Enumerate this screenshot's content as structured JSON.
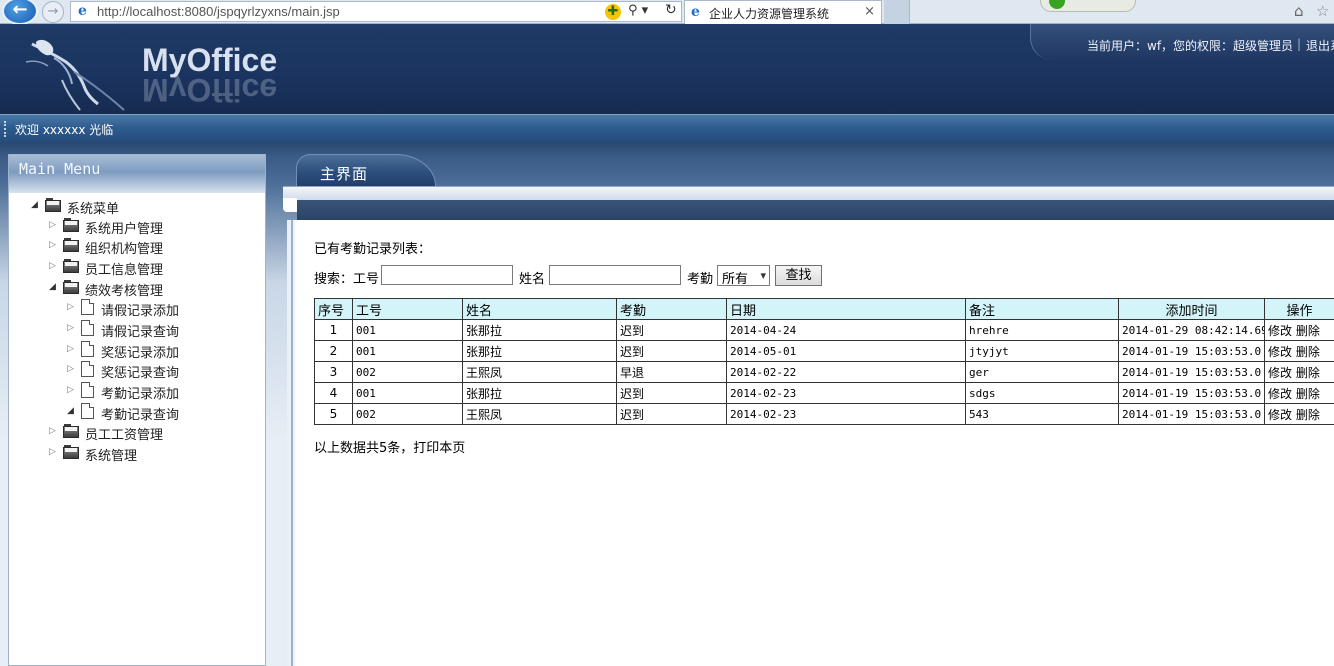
{
  "browser": {
    "url": "http://localhost:8080/jspqyrlzyxns/main.jsp",
    "tab_title": "企业人力资源管理系统",
    "back_glyph": "←",
    "forward_glyph": "→",
    "search_glyph": "⚲ ▾",
    "refresh_glyph": "↻",
    "close_glyph": "×"
  },
  "header": {
    "logo_text": "MyOffice",
    "user_info": "当前用户：wf，您的权限：超级管理员",
    "separator": "|",
    "logout_label": "退出系"
  },
  "welcome": {
    "text": "欢迎 xxxxxx 光临"
  },
  "sidebar": {
    "title": "Main Menu",
    "root_label": "系统菜单",
    "items": [
      {
        "label": "系统用户管理"
      },
      {
        "label": "组织机构管理"
      },
      {
        "label": "员工信息管理"
      },
      {
        "label": "绩效考核管理"
      },
      {
        "label": "请假记录添加"
      },
      {
        "label": "请假记录查询"
      },
      {
        "label": "奖惩记录添加"
      },
      {
        "label": "奖惩记录查询"
      },
      {
        "label": "考勤记录添加"
      },
      {
        "label": "考勤记录查询"
      },
      {
        "label": "员工工资管理"
      },
      {
        "label": "系统管理"
      }
    ]
  },
  "main": {
    "tab_label": "主界面",
    "list_title": "已有考勤记录列表：",
    "search": {
      "prefix_label": "搜索：工号：",
      "name_label": "姓名",
      "attendance_label": "考勤",
      "attendance_selected": "所有",
      "button_label": "查找",
      "id_value": "",
      "name_value": ""
    },
    "table": {
      "headers": [
        "序号",
        "工号",
        "姓名",
        "考勤",
        "日期",
        "备注",
        "添加时间",
        "操作"
      ],
      "rows": [
        {
          "no": "1",
          "id": "001",
          "name": "张那拉",
          "attendance": "迟到",
          "date": "2014-04-24",
          "note": "hrehre",
          "added": "2014-01-29 08:42:14.69",
          "edit": "修改",
          "delete": "删除"
        },
        {
          "no": "2",
          "id": "001",
          "name": "张那拉",
          "attendance": "迟到",
          "date": "2014-05-01",
          "note": "jtyjyt",
          "added": "2014-01-19 15:03:53.0",
          "edit": "修改",
          "delete": "删除"
        },
        {
          "no": "3",
          "id": "002",
          "name": "王熙凤",
          "attendance": "早退",
          "date": "2014-02-22",
          "note": "ger",
          "added": "2014-01-19 15:03:53.0",
          "edit": "修改",
          "delete": "删除"
        },
        {
          "no": "4",
          "id": "001",
          "name": "张那拉",
          "attendance": "迟到",
          "date": "2014-02-23",
          "note": "sdgs",
          "added": "2014-01-19 15:03:53.0",
          "edit": "修改",
          "delete": "删除"
        },
        {
          "no": "5",
          "id": "002",
          "name": "王熙凤",
          "attendance": "迟到",
          "date": "2014-02-23",
          "note": "543",
          "added": "2014-01-19 15:03:53.0",
          "edit": "修改",
          "delete": "删除"
        }
      ]
    },
    "footer_note": "以上数据共5条，打印本页"
  },
  "colors": {
    "header_bg": "#1f3a66",
    "table_header_bg": "#d3f4f8",
    "welcome_bar": "#2d5a8c"
  }
}
